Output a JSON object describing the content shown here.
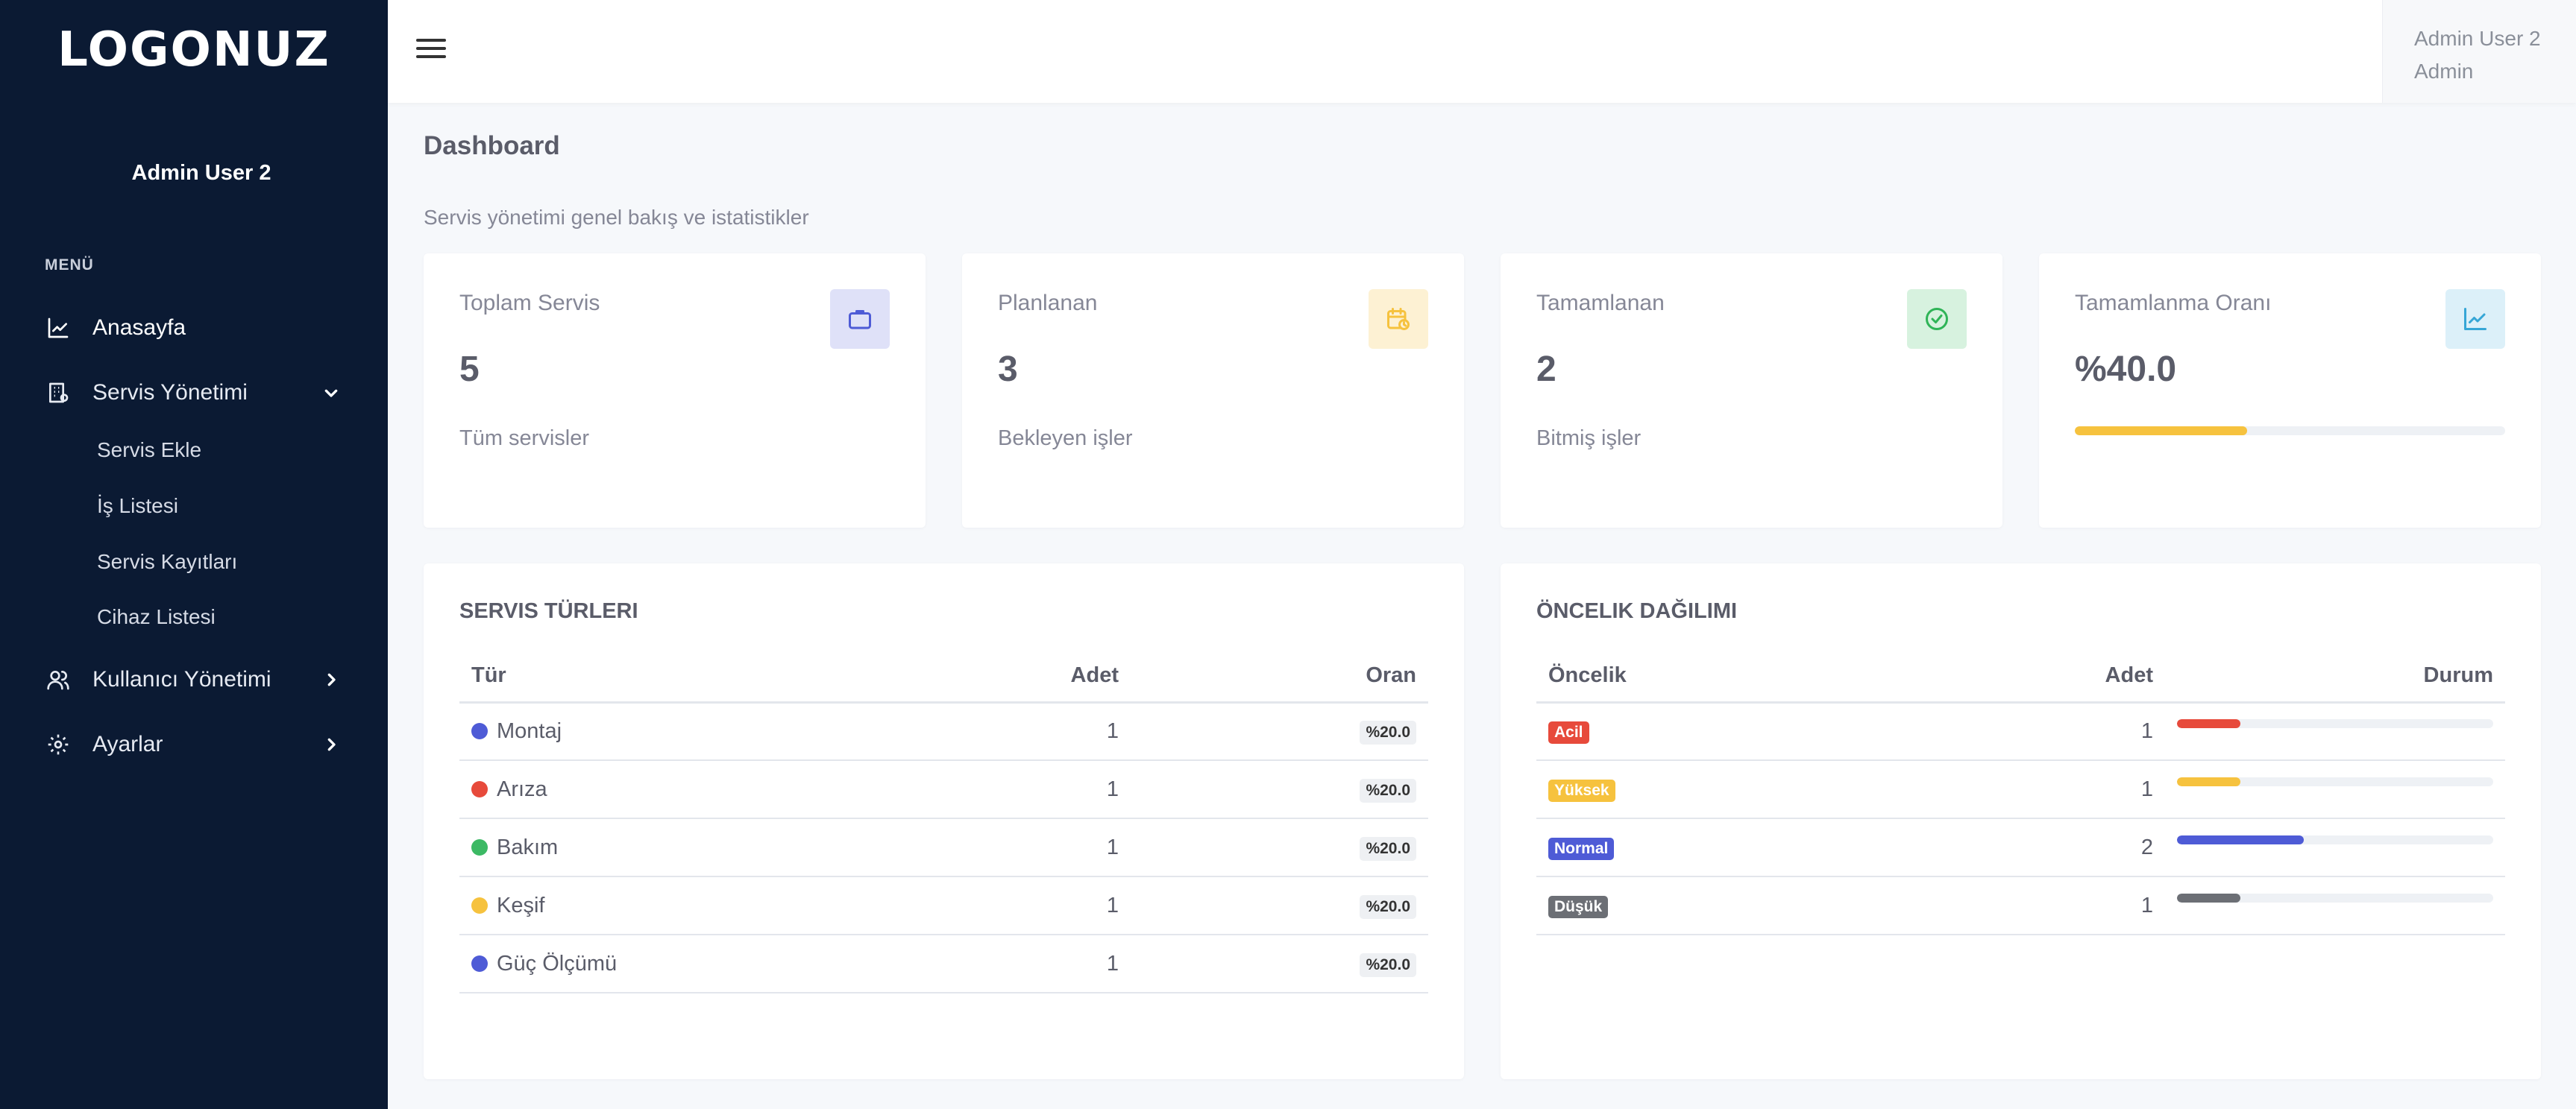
{
  "brand": {
    "logo": "LOGONUZ"
  },
  "sidebar": {
    "user_name": "Admin User 2",
    "section": "MENÜ",
    "items": [
      {
        "label": "Anasayfa",
        "icon": "chart-line-icon"
      },
      {
        "label": "Servis Yönetimi",
        "icon": "building-icon",
        "expanded": true,
        "children": [
          "Servis Ekle",
          "İş Listesi",
          "Servis Kayıtları",
          "Cihaz Listesi"
        ]
      },
      {
        "label": "Kullanıcı Yönetimi",
        "icon": "users-icon"
      },
      {
        "label": "Ayarlar",
        "icon": "gear-icon"
      }
    ]
  },
  "topbar": {
    "user_name": "Admin User 2",
    "user_role": "Admin"
  },
  "page": {
    "title": "Dashboard",
    "subtitle": "Servis yönetimi genel bakış ve istatistikler"
  },
  "stats": [
    {
      "label": "Toplam Servis",
      "value": "5",
      "footer": "Tüm servisler",
      "icon": "briefcase-icon",
      "color": "#4e5bd6",
      "bg": "#dfe1f8"
    },
    {
      "label": "Planlanan",
      "value": "3",
      "footer": "Bekleyen işler",
      "icon": "calendar-clock-icon",
      "color": "#f6c23e",
      "bg": "#fdf1d3"
    },
    {
      "label": "Tamamlanan",
      "value": "2",
      "footer": "Bitmiş işler",
      "icon": "check-circle-icon",
      "color": "#2fb457",
      "bg": "#d7f2df"
    },
    {
      "label": "Tamamlanma Oranı",
      "value": "%40.0",
      "progress": 0.4,
      "icon": "chart-line-icon",
      "color": "#36a6d6",
      "bg": "#dcf0f9"
    }
  ],
  "service_types": {
    "title": "SERVIS TÜRLERI",
    "headers": [
      "Tür",
      "Adet",
      "Oran"
    ],
    "rows": [
      {
        "name": "Montaj",
        "count": "1",
        "ratio": "%20.0",
        "color": "#4e5bd6"
      },
      {
        "name": "Arıza",
        "count": "1",
        "ratio": "%20.0",
        "color": "#e74a3b"
      },
      {
        "name": "Bakım",
        "count": "1",
        "ratio": "%20.0",
        "color": "#3cb964"
      },
      {
        "name": "Keşif",
        "count": "1",
        "ratio": "%20.0",
        "color": "#f6c23e"
      },
      {
        "name": "Güç Ölçümü",
        "count": "1",
        "ratio": "%20.0",
        "color": "#4e5bd6"
      }
    ]
  },
  "priority": {
    "title": "ÖNCELIK DAĞILIMI",
    "headers": [
      "Öncelik",
      "Adet",
      "Durum"
    ],
    "rows": [
      {
        "name": "Acil",
        "count": "1",
        "share": 0.2,
        "color": "#e74a3b"
      },
      {
        "name": "Yüksek",
        "count": "1",
        "share": 0.2,
        "color": "#f6c23e"
      },
      {
        "name": "Normal",
        "count": "2",
        "share": 0.4,
        "color": "#4e5bd6"
      },
      {
        "name": "Düşük",
        "count": "1",
        "share": 0.2,
        "color": "#6c6f75"
      }
    ]
  }
}
